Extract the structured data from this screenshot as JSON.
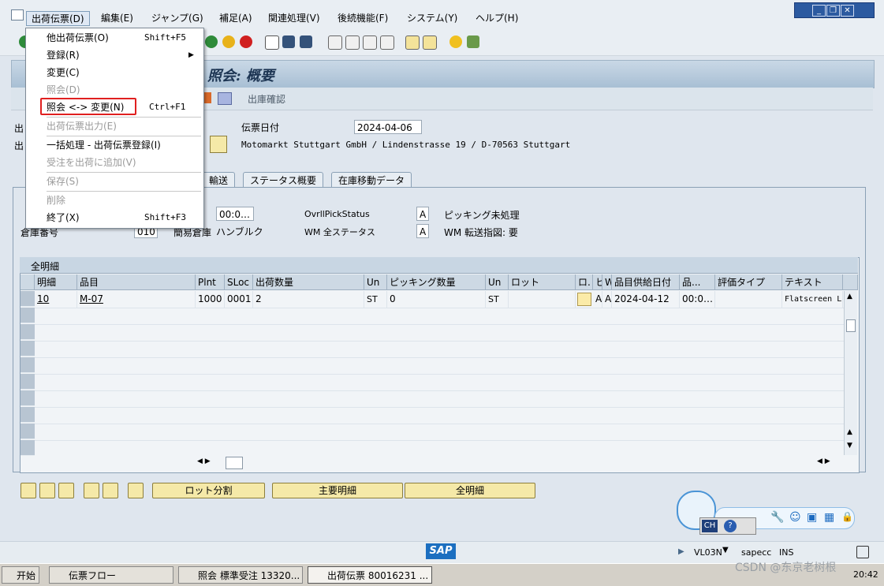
{
  "menubar": {
    "items": [
      "出荷伝票(D)",
      "編集(E)",
      "ジャンプ(G)",
      "補足(A)",
      "関連処理(V)",
      "後続機能(F)",
      "システム(Y)",
      "ヘルプ(H)"
    ]
  },
  "dropdown": {
    "items": [
      {
        "label": "他出荷伝票(O)",
        "shortcut": "Shift+F5",
        "disabled": false
      },
      {
        "label": "登録(R)",
        "shortcut": "",
        "disabled": false,
        "submenu": true
      },
      {
        "label": "変更(C)",
        "shortcut": "",
        "disabled": false
      },
      {
        "label": "照会(D)",
        "shortcut": "",
        "disabled": true
      },
      {
        "label": "照会 <-> 変更(N)",
        "shortcut": "Ctrl+F1",
        "disabled": false,
        "highlighted": true
      },
      {
        "label": "出荷伝票出力(E)",
        "shortcut": "",
        "disabled": true
      },
      {
        "label": "一括処理 - 出荷伝票登録(I)",
        "shortcut": "",
        "disabled": false
      },
      {
        "label": "受注を出荷に追加(V)",
        "shortcut": "",
        "disabled": true
      },
      {
        "label": "保存(S)",
        "shortcut": "",
        "disabled": true
      },
      {
        "label": "削除",
        "shortcut": "",
        "disabled": true
      },
      {
        "label": "終了(X)",
        "shortcut": "Shift+F3",
        "disabled": false
      }
    ]
  },
  "title": "照会: 概要",
  "apptoolbar": {
    "button": "出庫確認"
  },
  "header": {
    "doc_date_label": "伝票日付",
    "doc_date_value": "2024-04-06",
    "address": "Motomarkt Stuttgart GmbH / Lindenstrasse 19 / D-70563 Stuttgart",
    "partial_label_1": "出",
    "partial_label_2": "出"
  },
  "tabs": [
    "輸送",
    "ステータス概要",
    "在庫移動データ"
  ],
  "panel": {
    "time_value": "00:0…",
    "pick_status_label": "OvrllPickStatus",
    "pick_status_value": "A",
    "pick_status_text": "ピッキング未処理",
    "wm_status_label": "WM 全ステータス",
    "wm_status_value": "A",
    "wm_status_text": "WM 転送指図: 要",
    "warehouse_label": "倉庫番号",
    "warehouse_value": "010",
    "simple_wh_label": "簡易倉庫",
    "simple_wh_value": "ハンブルク"
  },
  "table": {
    "title": "全明細",
    "columns": [
      "明細",
      "品目",
      "Plnt",
      "SLoc",
      "出荷数量",
      "Un",
      "ピッキング数量",
      "Un",
      "ロット",
      "ロ.",
      "ヒ",
      "W.",
      "品目供給日付",
      "品...",
      "評価タイプ",
      "テキスト"
    ],
    "rows": [
      [
        "10",
        "M-07",
        "1000",
        "0001",
        "2",
        "ST",
        "0",
        "ST",
        "",
        "",
        "A",
        "A",
        "2024-04-12",
        "00:0…",
        "",
        "Flatscreen LE"
      ]
    ]
  },
  "buttons": {
    "batch_split": "ロット分割",
    "main_items": "主要明細",
    "all_items": "全明細"
  },
  "floating": {
    "ch": "CH"
  },
  "statusbar": {
    "tcode": "VL03N",
    "server": "sapecc",
    "mode": "INS",
    "sap": "SAP"
  },
  "taskbar": {
    "start": "开始",
    "tasks": [
      "伝票フロー",
      "照会 標準受注 13320...",
      "出荷伝票 80016231 ..."
    ],
    "watermark": "CSDN @东京老树根",
    "time": "20:42"
  },
  "colors": {
    "accent_red": "#e02020",
    "title_text": "#1d3553",
    "button_yellow": "#f5e9a8"
  }
}
